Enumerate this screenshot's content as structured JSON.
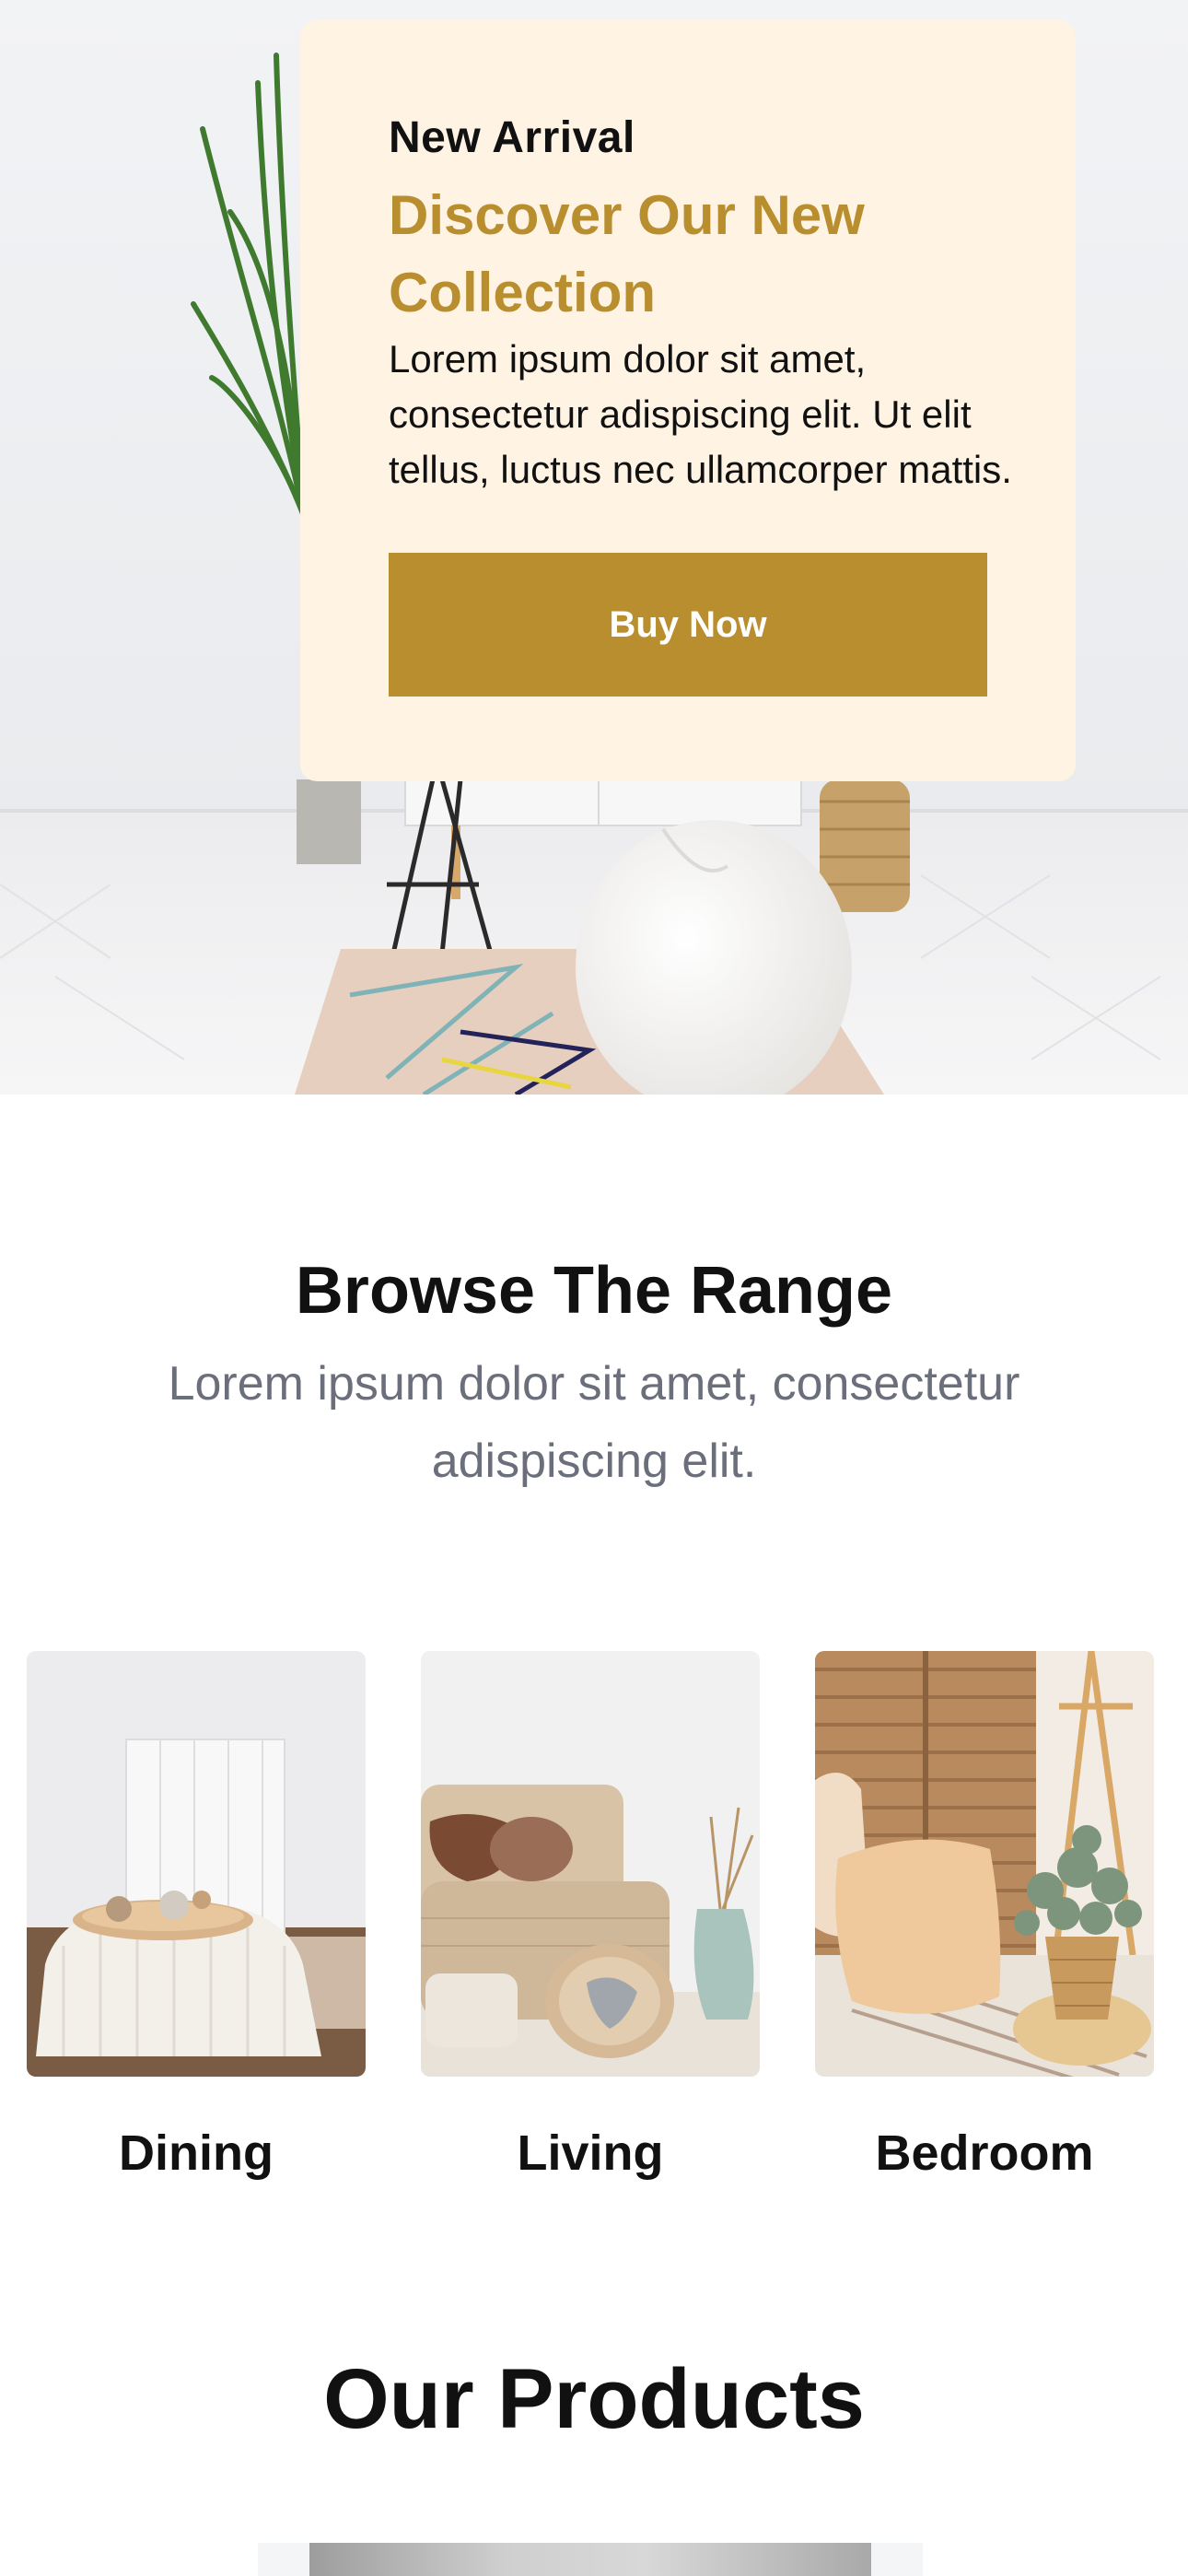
{
  "hero": {
    "eyebrow": "New Arrival",
    "title": "Discover Our New Collection",
    "text": "Lorem ipsum dolor sit amet, consectetur adispiscing elit. Ut elit tellus, luctus nec ullamcorper mattis.",
    "button_label": "Buy Now"
  },
  "browse": {
    "title": "Browse The Range",
    "subtitle": "Lorem ipsum dolor sit amet, consectetur adispiscing elit.",
    "categories": [
      {
        "label": "Dining"
      },
      {
        "label": "Living"
      },
      {
        "label": "Bedroom"
      }
    ]
  },
  "products": {
    "title": "Our Products"
  },
  "colors": {
    "accent": "#b88e2f",
    "card_bg": "#fff3e3",
    "muted_text": "#6b6f7b"
  }
}
